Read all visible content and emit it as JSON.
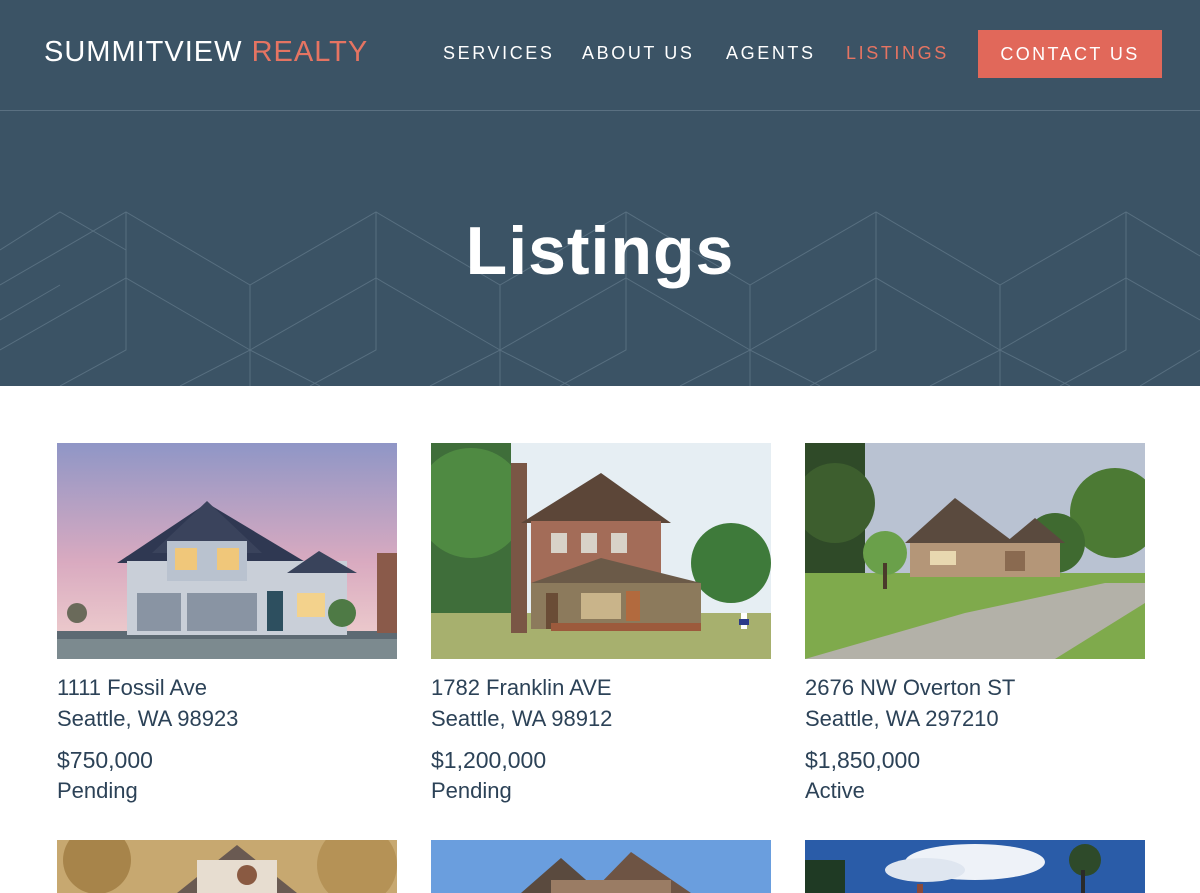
{
  "header": {
    "brand_main": "SUMMITVIEW",
    "brand_accent": "REALTY",
    "nav": [
      {
        "label": "SERVICES"
      },
      {
        "label": "ABOUT US"
      },
      {
        "label": "AGENTS"
      },
      {
        "label": "LISTINGS",
        "active": true
      }
    ],
    "contact_label": "CONTACT US"
  },
  "hero": {
    "title": "Listings"
  },
  "listings": [
    {
      "street": "1111 Fossil Ave",
      "city": "Seattle, WA 98923",
      "price": "$750,000",
      "status": "Pending",
      "photo": "house-photo"
    },
    {
      "street": "1782 Franklin AVE",
      "city": "Seattle, WA 98912",
      "price": "$1,200,000",
      "status": "Pending",
      "photo": "house-photo"
    },
    {
      "street": "2676 NW Overton ST",
      "city": "Seattle, WA 297210",
      "price": "$1,850,000",
      "status": "Active",
      "photo": "house-photo"
    }
  ],
  "colors": {
    "navy": "#3b5365",
    "accent": "#e1685a",
    "text": "#2c4257"
  }
}
